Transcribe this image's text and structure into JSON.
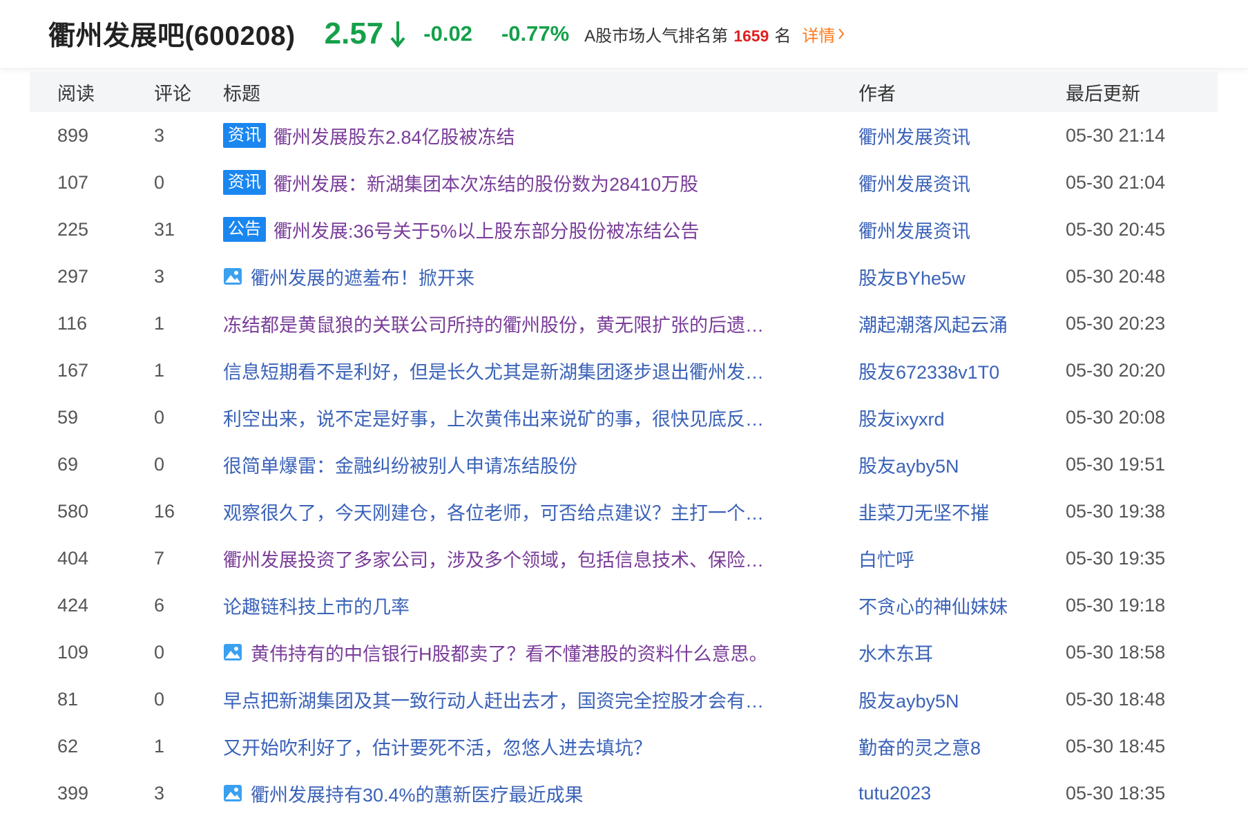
{
  "header": {
    "bar_name": "衢州发展吧(600208)",
    "price": "2.57",
    "change": "-0.02",
    "change_pct": "-0.77%",
    "rank_prefix": "A股市场人气排名第",
    "rank_value": "1659",
    "rank_suffix": "名",
    "details_label": "详情",
    "price_color": "#15a04a",
    "arrow_icon": "arrow-down-icon"
  },
  "table": {
    "columns": {
      "read": "阅读",
      "comment": "评论",
      "title": "标题",
      "author": "作者",
      "updated": "最后更新"
    },
    "rows": [
      {
        "read": "899",
        "comment": "3",
        "tag": "资讯",
        "icon": "",
        "title": "衢州发展股东2.84亿股被冻结",
        "title_style": "purple",
        "author": "衢州发展资讯",
        "updated": "05-30 21:14"
      },
      {
        "read": "107",
        "comment": "0",
        "tag": "资讯",
        "icon": "",
        "title": "衢州发展：新湖集团本次冻结的股份数为28410万股",
        "title_style": "purple",
        "author": "衢州发展资讯",
        "updated": "05-30 21:04"
      },
      {
        "read": "225",
        "comment": "31",
        "tag": "公告",
        "icon": "",
        "title": "衢州发展:36号关于5%以上股东部分股份被冻结公告",
        "title_style": "purple",
        "author": "衢州发展资讯",
        "updated": "05-30 20:45"
      },
      {
        "read": "297",
        "comment": "3",
        "tag": "",
        "icon": "image-icon",
        "title": "衢州发展的遮羞布！掀开来",
        "title_style": "blue",
        "author": "股友BYhe5w",
        "updated": "05-30 20:48"
      },
      {
        "read": "116",
        "comment": "1",
        "tag": "",
        "icon": "",
        "title": "冻结都是黄鼠狼的关联公司所持的衢州股份，黄无限扩张的后遗…",
        "title_style": "purple",
        "author": "潮起潮落风起云涌",
        "updated": "05-30 20:23"
      },
      {
        "read": "167",
        "comment": "1",
        "tag": "",
        "icon": "",
        "title": "信息短期看不是利好，但是长久尤其是新湖集团逐步退出衢州发…",
        "title_style": "blue",
        "author": "股友672338v1T0",
        "updated": "05-30 20:20"
      },
      {
        "read": "59",
        "comment": "0",
        "tag": "",
        "icon": "",
        "title": "利空出来，说不定是好事，上次黄伟出来说矿的事，很快见底反…",
        "title_style": "blue",
        "author": "股友ixyxrd",
        "updated": "05-30 20:08"
      },
      {
        "read": "69",
        "comment": "0",
        "tag": "",
        "icon": "",
        "title": "很简单爆雷：金融纠纷被别人申请冻结股份",
        "title_style": "blue",
        "author": "股友ayby5N",
        "updated": "05-30 19:51"
      },
      {
        "read": "580",
        "comment": "16",
        "tag": "",
        "icon": "",
        "title": "观察很久了，今天刚建仓，各位老师，可否给点建议？主打一个…",
        "title_style": "blue",
        "author": "韭菜刀无坚不摧",
        "updated": "05-30 19:38"
      },
      {
        "read": "404",
        "comment": "7",
        "tag": "",
        "icon": "",
        "title": "衢州发展投资了多家公司，涉及多个领域，包括信息技术、保险…",
        "title_style": "purple",
        "author": "白忙呼",
        "updated": "05-30 19:35"
      },
      {
        "read": "424",
        "comment": "6",
        "tag": "",
        "icon": "",
        "title": "论趣链科技上市的几率",
        "title_style": "blue",
        "author": "不贪心的神仙妹妹",
        "updated": "05-30 19:18"
      },
      {
        "read": "109",
        "comment": "0",
        "tag": "",
        "icon": "image-icon",
        "title": "黄伟持有的中信银行H股都卖了？看不懂港股的资料什么意思。",
        "title_style": "purple",
        "author": "水木东耳",
        "updated": "05-30 18:58"
      },
      {
        "read": "81",
        "comment": "0",
        "tag": "",
        "icon": "",
        "title": "早点把新湖集团及其一致行动人赶出去才，国资完全控股才会有…",
        "title_style": "blue",
        "author": "股友ayby5N",
        "updated": "05-30 18:48"
      },
      {
        "read": "62",
        "comment": "1",
        "tag": "",
        "icon": "",
        "title": "又开始吹利好了，估计要死不活，忽悠人进去填坑？",
        "title_style": "blue",
        "author": "勤奋的灵之意8",
        "updated": "05-30 18:45"
      },
      {
        "read": "399",
        "comment": "3",
        "tag": "",
        "icon": "image-icon",
        "title": "衢州发展持有30.4%的蕙新医疗最近成果",
        "title_style": "blue",
        "author": "tutu2023",
        "updated": "05-30 18:35"
      }
    ]
  },
  "colors": {
    "link_blue": "#3a62b8",
    "visited_purple": "#7a3d99",
    "tag_blue": "#1a86f0",
    "down_green": "#15a04a",
    "rank_red": "#e02020",
    "details_orange": "#ff7a1a"
  }
}
